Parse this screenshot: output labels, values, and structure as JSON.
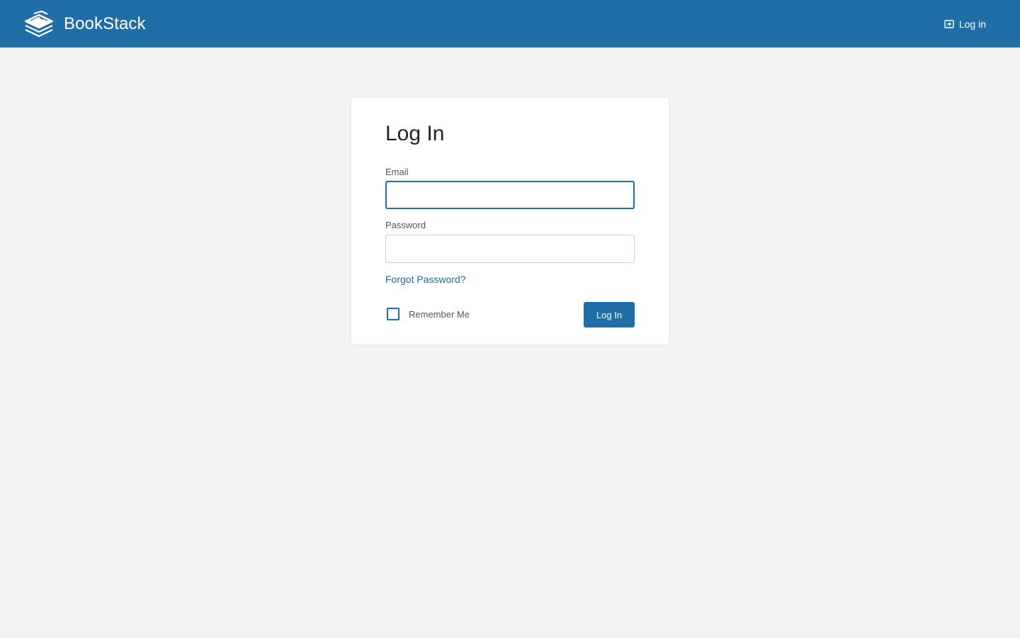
{
  "header": {
    "brand_name": "BookStack",
    "brand_logo_icon": "bookstack-logo-icon",
    "login_link_label": "Log in",
    "login_link_icon": "login-icon",
    "background_color": "#206ea7"
  },
  "login_form": {
    "title": "Log In",
    "email_label": "Email",
    "email_value": "",
    "password_label": "Password",
    "password_value": "",
    "forgot_password_label": "Forgot Password?",
    "remember_me_label": "Remember Me",
    "remember_me_checked": false,
    "submit_label": "Log In"
  },
  "colors": {
    "accent": "#206ea7",
    "page_background": "#f2f2f2",
    "card_background": "#ffffff"
  }
}
